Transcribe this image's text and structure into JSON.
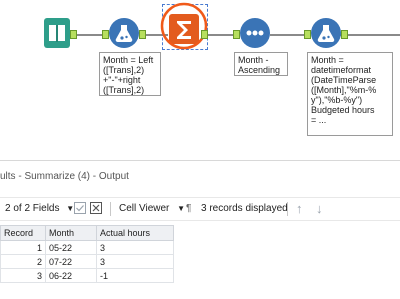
{
  "workflow": {
    "tools": [
      {
        "name": "input-data-tool",
        "icon": "book-icon"
      },
      {
        "name": "formula-tool-month",
        "icon": "flask-icon"
      },
      {
        "name": "summarize-tool",
        "icon": "sigma-icon"
      },
      {
        "name": "sort-tool",
        "icon": "sort-icon"
      },
      {
        "name": "formula-tool-date",
        "icon": "flask-icon"
      }
    ],
    "annotations": {
      "formula1": "Month = Left\n([Trans],2)\n+\"-\"+right\n([Trans],2)",
      "sort": "Month -\nAscending",
      "formula2": "Month =\ndatetimeformat\n(DateTimeParse\n([Month],\"%m-%\ny\"),\"%b-%y\")\nBudgeted hours\n= ..."
    },
    "colors": {
      "input": "#2e9e8a",
      "formula": "#3a74b6",
      "summarize": "#e35b1e",
      "sort": "#3a74b6",
      "highlight": "#f05a1a"
    }
  },
  "results": {
    "title": "ults - Summarize (4) - Output",
    "fields_selector": "2 of 2 Fields",
    "cell_viewer": "Cell Viewer",
    "records_status": "3 records displayed",
    "pilcrow": "¶",
    "columns": [
      "Record",
      "Month",
      "Actual hours"
    ],
    "rows": [
      {
        "record": "1",
        "month": "05-22",
        "hours": "3"
      },
      {
        "record": "2",
        "month": "07-22",
        "hours": "3"
      },
      {
        "record": "3",
        "month": "06-22",
        "hours": "-1"
      }
    ]
  }
}
